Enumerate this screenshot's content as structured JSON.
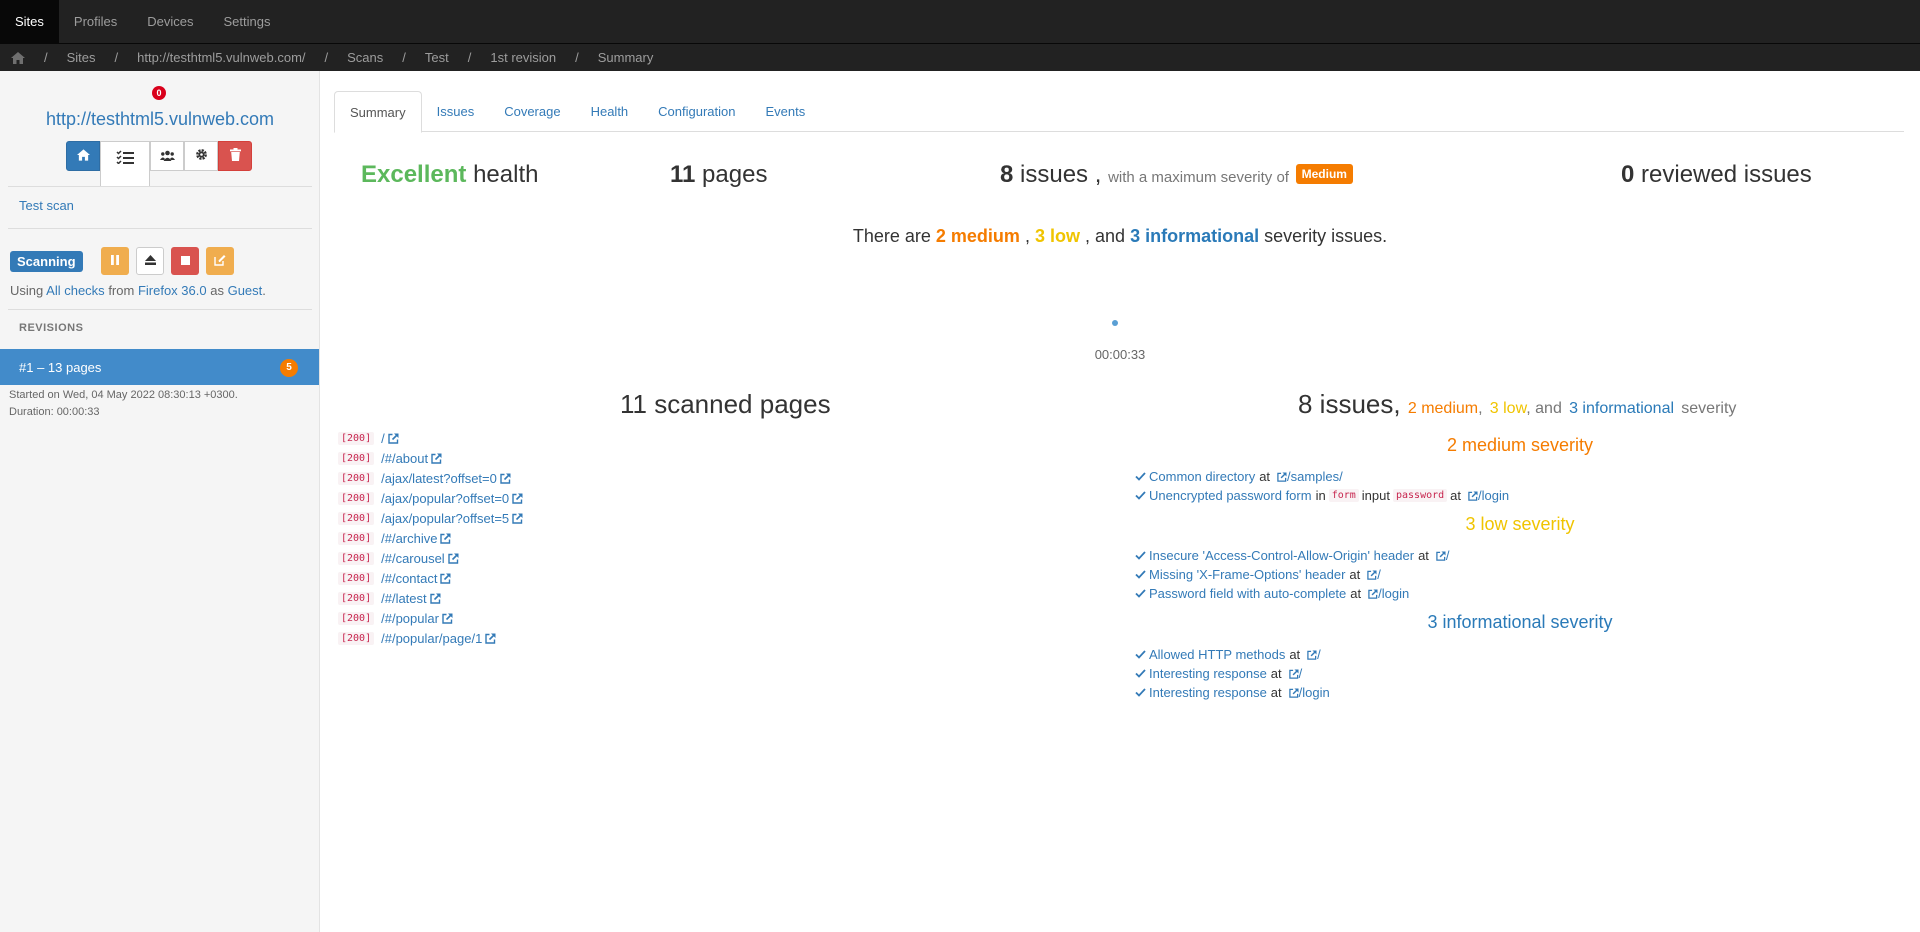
{
  "nav": {
    "items": [
      {
        "label": "Sites",
        "active": true
      },
      {
        "label": "Profiles",
        "active": false
      },
      {
        "label": "Devices",
        "active": false
      },
      {
        "label": "Settings",
        "active": false
      }
    ]
  },
  "breadcrumb": {
    "items": [
      "Sites",
      "http://testhtml5.vulnweb.com/",
      "Scans",
      "Test",
      "1st revision",
      "Summary"
    ],
    "separator": "/"
  },
  "sidebar": {
    "notification_count": "0",
    "site_url": "http://testhtml5.vulnweb.com",
    "scan_name": "Test scan",
    "status": "Scanning",
    "using": {
      "prefix": "Using",
      "checks": "All checks",
      "from": "from",
      "browser": "Firefox 36.0",
      "as": "as",
      "user": "Guest",
      "suffix": "."
    },
    "revisions_heading": "REVISIONS",
    "revision": {
      "label": "#1 – 13 pages",
      "badge": "5"
    },
    "started": "Started on Wed, 04 May 2022 08:30:13 +0300.",
    "duration": "Duration: 00:00:33"
  },
  "tabs": [
    "Summary",
    "Issues",
    "Coverage",
    "Health",
    "Configuration",
    "Events"
  ],
  "stats": {
    "health_word": "Excellent",
    "health_suffix": "health",
    "pages_count": "11",
    "pages_label": "pages",
    "issues_count": "8",
    "issues_label": "issues ,",
    "max_sev_text": "with a maximum severity of",
    "max_sev": "Medium",
    "reviewed_count": "0",
    "reviewed_label": "reviewed issues"
  },
  "summary": {
    "prefix": "There are",
    "medium": "2 medium",
    "sep1": ",",
    "low": "3 low",
    "sep2": ", and",
    "info": "3 informational",
    "suffix": "severity issues."
  },
  "progress_time": "00:00:33",
  "scanned_pages": {
    "title": "11 scanned pages",
    "pages": [
      {
        "code": "[200]",
        "path": "/"
      },
      {
        "code": "[200]",
        "path": "/#/about"
      },
      {
        "code": "[200]",
        "path": "/ajax/latest?offset=0"
      },
      {
        "code": "[200]",
        "path": "/ajax/popular?offset=0"
      },
      {
        "code": "[200]",
        "path": "/ajax/popular?offset=5"
      },
      {
        "code": "[200]",
        "path": "/#/archive"
      },
      {
        "code": "[200]",
        "path": "/#/carousel"
      },
      {
        "code": "[200]",
        "path": "/#/contact"
      },
      {
        "code": "[200]",
        "path": "/#/latest"
      },
      {
        "code": "[200]",
        "path": "/#/popular"
      },
      {
        "code": "[200]",
        "path": "/#/popular/page/1"
      }
    ]
  },
  "issues_section": {
    "title_main": "8 issues,",
    "medium": "2 medium",
    "comma": ",",
    "low": "3 low",
    "and": ", and",
    "info": "3 informational",
    "suffix": "severity",
    "at": "at",
    "in": "in",
    "input": "input",
    "medium_heading": "2 medium severity",
    "low_heading": "3 low severity",
    "info_heading": "3 informational severity",
    "medium_issues": [
      {
        "name": "Common directory",
        "url": "/samples/"
      },
      {
        "name": "Unencrypted password form",
        "element": "form",
        "input": "password",
        "url": "/login"
      }
    ],
    "low_issues": [
      {
        "name": "Insecure 'Access-Control-Allow-Origin' header",
        "url": "/"
      },
      {
        "name": "Missing 'X-Frame-Options' header",
        "url": "/"
      },
      {
        "name": "Password field with auto-complete",
        "url": "/login"
      }
    ],
    "info_issues": [
      {
        "name": "Allowed HTTP methods",
        "url": "/"
      },
      {
        "name": "Interesting response",
        "url": "/"
      },
      {
        "name": "Interesting response",
        "url": "/login"
      }
    ]
  },
  "colors": {
    "nav_bg": "#222222",
    "primary": "#337ab7",
    "medium": "#f57c00",
    "low": "#f0c400",
    "informational": "#2a7ab8",
    "health_good": "#5cb85c",
    "danger": "#d9534f",
    "warning": "#f0ad4e"
  },
  "icons": [
    "home-icon",
    "checklist-icon",
    "users-icon",
    "gear-icon",
    "trash-icon",
    "pause-icon",
    "eject-icon",
    "stop-icon",
    "edit-icon",
    "external-link-icon",
    "check-icon"
  ]
}
